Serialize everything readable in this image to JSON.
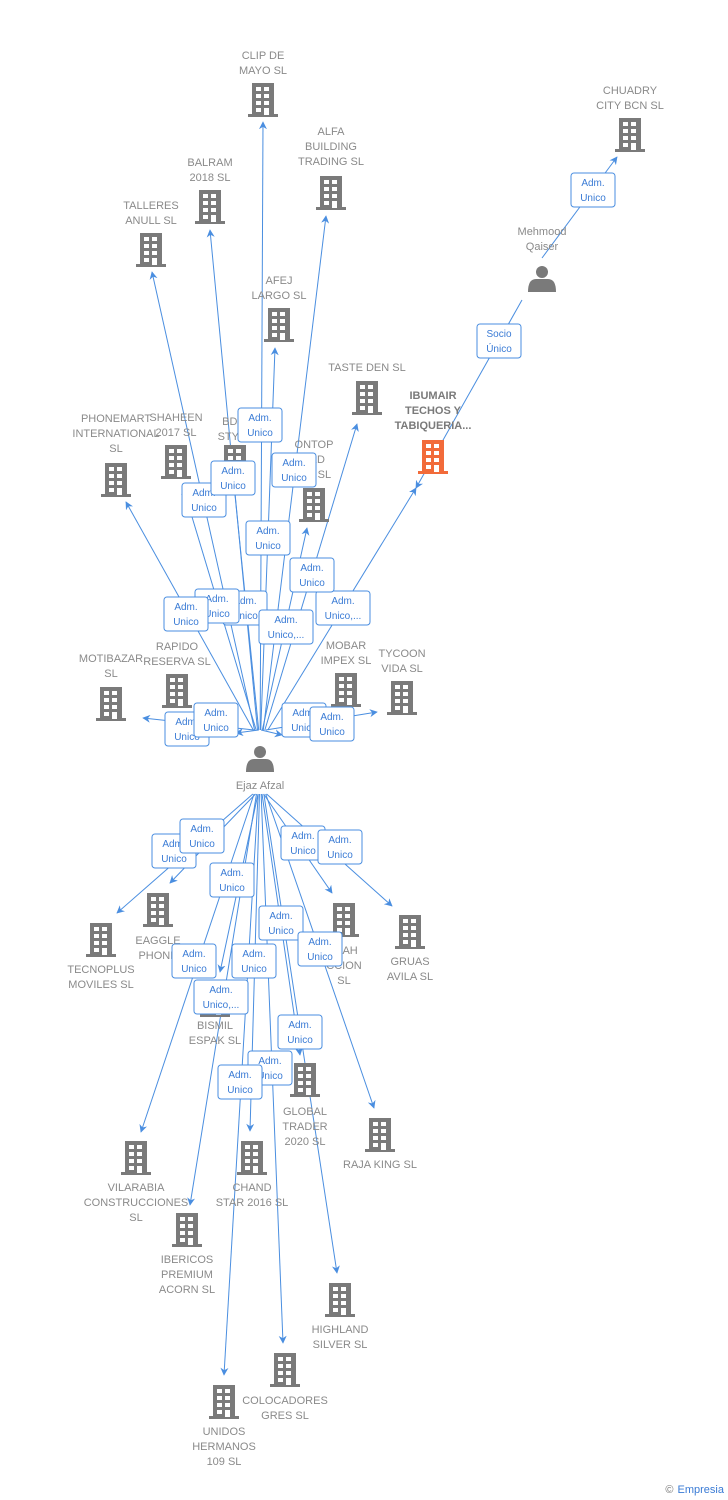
{
  "colors": {
    "edge": "#4a8ee0",
    "company": "#7a7a7a",
    "highlight": "#f26b3a",
    "label": "#8a8a8a"
  },
  "nodes": [
    {
      "id": "ejaz",
      "type": "person",
      "lines": [
        "Ejaz Afzal"
      ]
    },
    {
      "id": "mehmood",
      "type": "person",
      "lines": [
        "Mehmood",
        "Qaiser"
      ]
    },
    {
      "id": "chuadry",
      "type": "company",
      "lines": [
        "CHUADRY",
        "CITY BCN  SL"
      ]
    },
    {
      "id": "ibumair",
      "type": "company",
      "highlight": true,
      "lines": [
        "IBUMAIR",
        "TECHOS Y",
        "TABIQUERIA..."
      ]
    },
    {
      "id": "clip",
      "type": "company",
      "lines": [
        "CLIP DE",
        "MAYO  SL"
      ]
    },
    {
      "id": "alfa",
      "type": "company",
      "lines": [
        "ALFA",
        "BUILDING",
        "TRADING  SL"
      ]
    },
    {
      "id": "balram",
      "type": "company",
      "lines": [
        "BALRAM",
        "2018  SL"
      ]
    },
    {
      "id": "talleres",
      "type": "company",
      "lines": [
        "TALLERES",
        "ANULL SL"
      ]
    },
    {
      "id": "afej",
      "type": "company",
      "lines": [
        "AFEJ",
        "LARGO  SL"
      ]
    },
    {
      "id": "taste",
      "type": "company",
      "lines": [
        "TASTE DEN  SL"
      ]
    },
    {
      "id": "phonemart",
      "type": "company",
      "lines": [
        "PHONEMART",
        "INTERNATIONAL",
        "SL"
      ]
    },
    {
      "id": "shaheen",
      "type": "company",
      "lines": [
        "SHAHEEN",
        "2017  SL"
      ]
    },
    {
      "id": "bd",
      "type": "company",
      "lines": [
        "BD S",
        "STYLE"
      ]
    },
    {
      "id": "ontop",
      "type": "company",
      "lines": [
        "ONTOP",
        "RLD",
        "OM  SL"
      ]
    },
    {
      "id": "motibazar",
      "type": "company",
      "lines": [
        "MOTIBAZAR",
        "SL"
      ]
    },
    {
      "id": "rapido",
      "type": "company",
      "lines": [
        "RAPIDO",
        "RESERVA  SL"
      ]
    },
    {
      "id": "mobar",
      "type": "company",
      "lines": [
        "MOBAR",
        "IMPEX SL"
      ]
    },
    {
      "id": "tycoon",
      "type": "company",
      "lines": [
        "TYCOON",
        "VIDA  SL"
      ]
    },
    {
      "id": "tecnoplus",
      "type": "company",
      "lines": [
        "TECNOPLUS",
        "MOVILES  SL"
      ]
    },
    {
      "id": "eaggle",
      "type": "company",
      "lines": [
        "EAGGLE",
        "PHONE"
      ]
    },
    {
      "id": "llah",
      "type": "company",
      "lines": [
        "LLAH",
        "CCION",
        "SL"
      ]
    },
    {
      "id": "gruas",
      "type": "company",
      "lines": [
        "GRUAS",
        "AVILA SL"
      ]
    },
    {
      "id": "bismil",
      "type": "company",
      "lines": [
        "BISMIL",
        "ESPAK  SL"
      ]
    },
    {
      "id": "global",
      "type": "company",
      "lines": [
        "GLOBAL",
        "TRADER",
        "2020  SL"
      ]
    },
    {
      "id": "raja",
      "type": "company",
      "lines": [
        "RAJA KING  SL"
      ]
    },
    {
      "id": "vilarabia",
      "type": "company",
      "lines": [
        "VILARABIA",
        "CONSTRUCCIONES",
        "SL"
      ]
    },
    {
      "id": "chand",
      "type": "company",
      "lines": [
        "CHAND",
        "STAR 2016  SL"
      ]
    },
    {
      "id": "ibericos",
      "type": "company",
      "lines": [
        "IBERICOS",
        "PREMIUM",
        "ACORN  SL"
      ]
    },
    {
      "id": "highland",
      "type": "company",
      "lines": [
        "HIGHLAND",
        "SILVER  SL"
      ]
    },
    {
      "id": "colocadores",
      "type": "company",
      "lines": [
        "COLOCADORES",
        "GRES  SL"
      ]
    },
    {
      "id": "unidos",
      "type": "company",
      "lines": [
        "UNIDOS",
        "HERMANOS",
        "109  SL"
      ]
    }
  ],
  "edges": [
    {
      "from": "mehmood",
      "to": "chuadry",
      "label": [
        "Adm.",
        "Unico"
      ]
    },
    {
      "from": "mehmood",
      "to": "ibumair",
      "label": [
        "Socio",
        "Único"
      ]
    },
    {
      "from": "ejaz",
      "to": "clip",
      "label": [
        "Adm.",
        "Unico"
      ]
    },
    {
      "from": "ejaz",
      "to": "alfa",
      "label": [
        "Adm.",
        "Unico"
      ]
    },
    {
      "from": "ejaz",
      "to": "balram",
      "label": [
        "Adm.",
        "Unico"
      ]
    },
    {
      "from": "ejaz",
      "to": "talleres",
      "label": [
        "Adm.",
        "Unico"
      ]
    },
    {
      "from": "ejaz",
      "to": "afej",
      "label": [
        "Adm.",
        "Unico"
      ]
    },
    {
      "from": "ejaz",
      "to": "taste",
      "label": [
        "Adm.",
        "Unico,..."
      ]
    },
    {
      "from": "ejaz",
      "to": "ibumair",
      "label": [
        "Adm.",
        "Unico,..."
      ]
    },
    {
      "from": "ejaz",
      "to": "phonemart",
      "label": [
        "Adm.",
        "Unico"
      ]
    },
    {
      "from": "ejaz",
      "to": "shaheen",
      "label": [
        "Adm.",
        "Unico"
      ]
    },
    {
      "from": "ejaz",
      "to": "bd",
      "label": [
        "Adm.",
        "Unico"
      ]
    },
    {
      "from": "ejaz",
      "to": "ontop",
      "label": [
        "Adm.",
        "Unico"
      ]
    },
    {
      "from": "ejaz",
      "to": "motibazar",
      "label": [
        "Adm.",
        "Unico"
      ]
    },
    {
      "from": "ejaz",
      "to": "rapido",
      "label": [
        "Adm.",
        "Unico"
      ]
    },
    {
      "from": "ejaz",
      "to": "mobar",
      "label": [
        "Adm.",
        "Unico"
      ]
    },
    {
      "from": "ejaz",
      "to": "tycoon",
      "label": [
        "Adm.",
        "Unico"
      ]
    },
    {
      "from": "ejaz",
      "to": "tecnoplus",
      "label": [
        "Adm.",
        "Unico"
      ]
    },
    {
      "from": "ejaz",
      "to": "eaggle",
      "label": [
        "Adm.",
        "Unico"
      ]
    },
    {
      "from": "ejaz",
      "to": "llah",
      "label": [
        "Adm.",
        "Unico"
      ]
    },
    {
      "from": "ejaz",
      "to": "gruas",
      "label": [
        "Adm.",
        "Unico"
      ]
    },
    {
      "from": "ejaz",
      "to": "bismil",
      "label": [
        "Adm.",
        "Unico"
      ]
    },
    {
      "from": "ejaz",
      "to": "global",
      "label": [
        "Adm.",
        "Unico"
      ]
    },
    {
      "from": "ejaz",
      "to": "raja",
      "label": [
        "Adm.",
        "Unico"
      ]
    },
    {
      "from": "ejaz",
      "to": "vilarabia",
      "label": [
        "Adm.",
        "Unico"
      ]
    },
    {
      "from": "ejaz",
      "to": "chand",
      "label": [
        "Adm.",
        "Unico"
      ]
    },
    {
      "from": "ejaz",
      "to": "ibericos",
      "label": [
        "Adm.",
        "Unico,..."
      ]
    },
    {
      "from": "ejaz",
      "to": "highland",
      "label": [
        "Adm.",
        "Unico"
      ]
    },
    {
      "from": "ejaz",
      "to": "colocadores",
      "label": [
        "Adm.",
        "Unico"
      ]
    },
    {
      "from": "ejaz",
      "to": "unidos",
      "label": [
        "Adm.",
        "Unico"
      ]
    }
  ],
  "footer": {
    "copyright": "©",
    "brand": "Empresia"
  }
}
